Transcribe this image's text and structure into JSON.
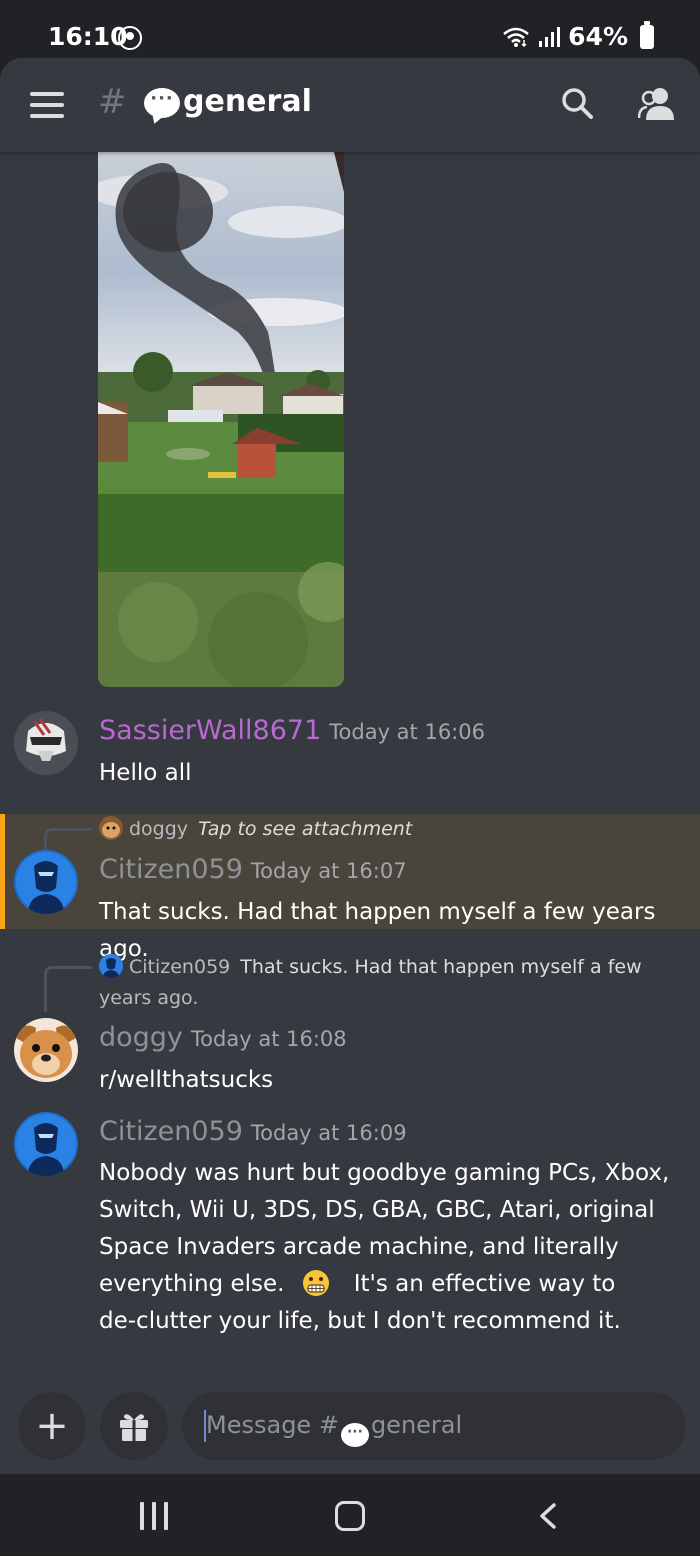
{
  "status_bar": {
    "time": "16:10",
    "battery": "64%"
  },
  "header": {
    "hash": "#",
    "channel_emoji": "···",
    "channel_name": "general"
  },
  "messages": [
    {
      "author": "SassierWall8671",
      "timestamp": "Today at 16:06",
      "text": "Hello all",
      "author_color": "#b86ad0"
    },
    {
      "reply": {
        "author": "doggy",
        "content": "Tap to see attachment"
      },
      "author": "Citizen059",
      "timestamp": "Today at 16:07",
      "text": "That sucks.  Had that happen myself a few years ago.",
      "author_color": "#8e9297",
      "highlighted": true
    },
    {
      "reply": {
        "author": "Citizen059",
        "content_line1": "That sucks.  Had that happen myself a few",
        "content_line2": "years ago."
      },
      "author": "doggy",
      "timestamp": "Today at 16:08",
      "text": "r/wellthatsucks",
      "author_color": "#8e9297"
    },
    {
      "author": "Citizen059",
      "timestamp": "Today at 16:09",
      "lines": [
        "Nobody was hurt but goodbye gaming PCs, Xbox,",
        "Switch, Wii U, 3DS, DS, GBA, GBC, Atari, original",
        "Space Invaders arcade machine, and literally",
        "everything else.",
        "It's an effective way to",
        "de-clutter your life, but I don't recommend it."
      ],
      "emoji": "grimacing-face",
      "author_color": "#8e9297"
    }
  ],
  "composer": {
    "plus_label": "+",
    "placeholder_prefix": "Message #",
    "placeholder_emoji": "···",
    "placeholder_channel": "general"
  },
  "colors": {
    "background": "#36393f",
    "highlight": "#49443c",
    "highlight_bar": "#faa61a",
    "accent": "#7289da"
  }
}
